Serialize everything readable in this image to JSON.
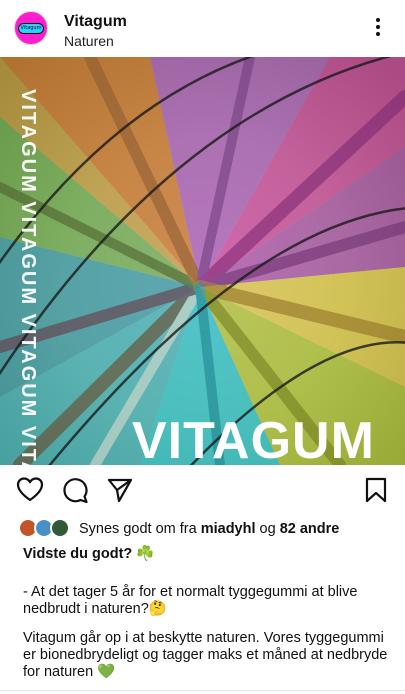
{
  "account": {
    "name": "Vitagum",
    "location": "Naturen",
    "avatar_text": "Vitagum"
  },
  "post_image": {
    "side_text": "VITAGUM VITAGUM VITAGUM VITAGUM",
    "overlay_text": "VITAGUM"
  },
  "likes": {
    "prefix": "Synes godt om fra",
    "user": "miadyhl",
    "conjunction": "og",
    "others": "82 andre"
  },
  "caption": {
    "title": "Vidste du godt? ☘️",
    "line1": "- At det tager 5 år for et normalt tyggegummi at blive nedbrudt i naturen?🤔",
    "line2": "Vitagum går op i at beskytte naturen. Vores tyggegummi er bionedbrydeligt og tagger maks et måned at nedbryde for naturen 💚"
  },
  "colors": {
    "accent_avatar": "#ff1dce",
    "pill": "#28d1ff"
  },
  "icons": [
    "more-icon",
    "heart-icon",
    "comment-icon",
    "share-icon",
    "bookmark-icon"
  ]
}
